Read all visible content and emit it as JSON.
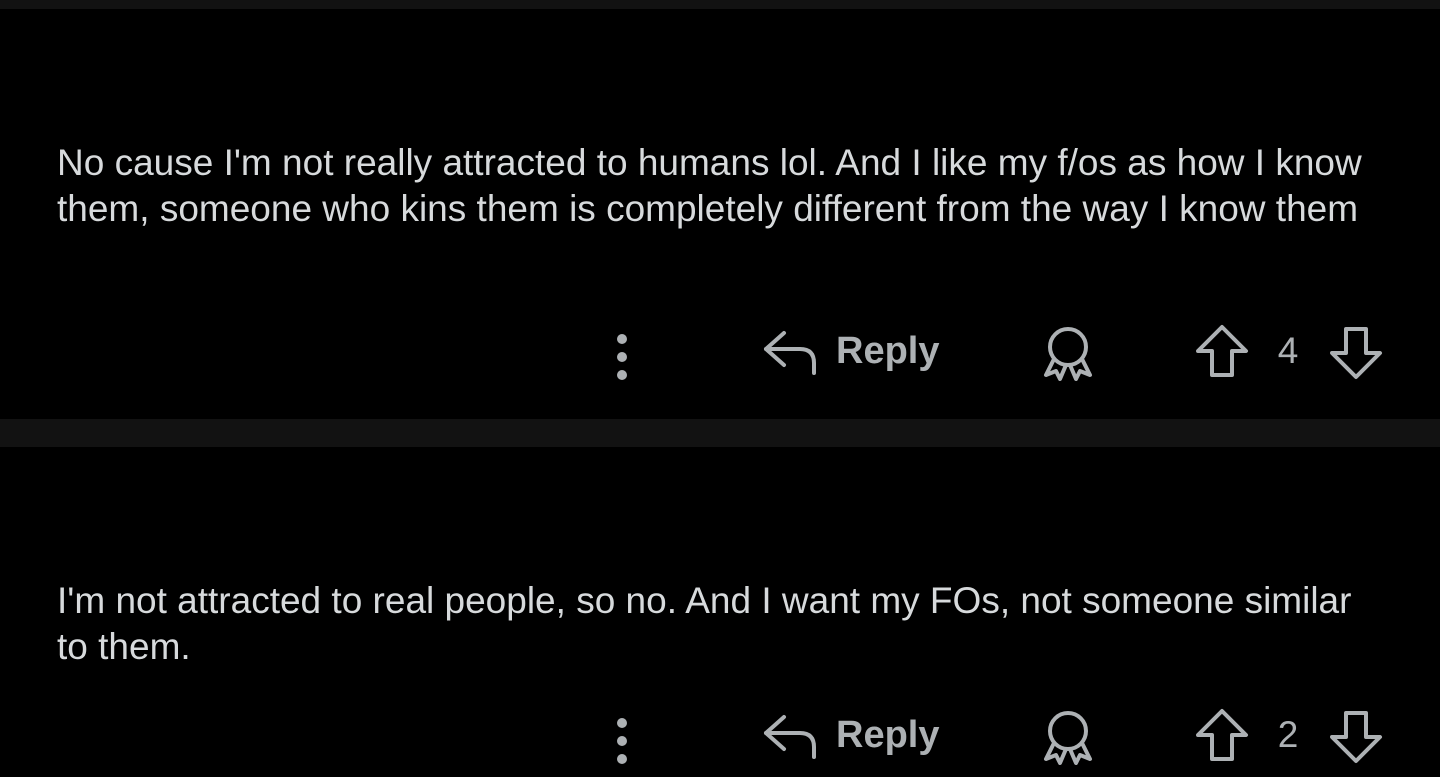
{
  "comments": [
    {
      "body": "No cause I'm not really attracted to humans lol. And I like my f/os as how I know them, someone who kins them is completely different from the way I know them",
      "reply_label": "Reply",
      "vote_count": "4"
    },
    {
      "body": "I'm not attracted to real people, so no. And I want my FOs, not someone similar to them.",
      "reply_label": "Reply",
      "vote_count": "2"
    }
  ],
  "icons": {
    "more": "more-options-icon",
    "reply": "reply-arrow-icon",
    "award": "award-icon",
    "upvote": "upvote-icon",
    "downvote": "downvote-icon"
  },
  "colors": {
    "background": "#000000",
    "divider": "#121212",
    "text": "#d7dadc",
    "muted": "#adb1b4"
  }
}
